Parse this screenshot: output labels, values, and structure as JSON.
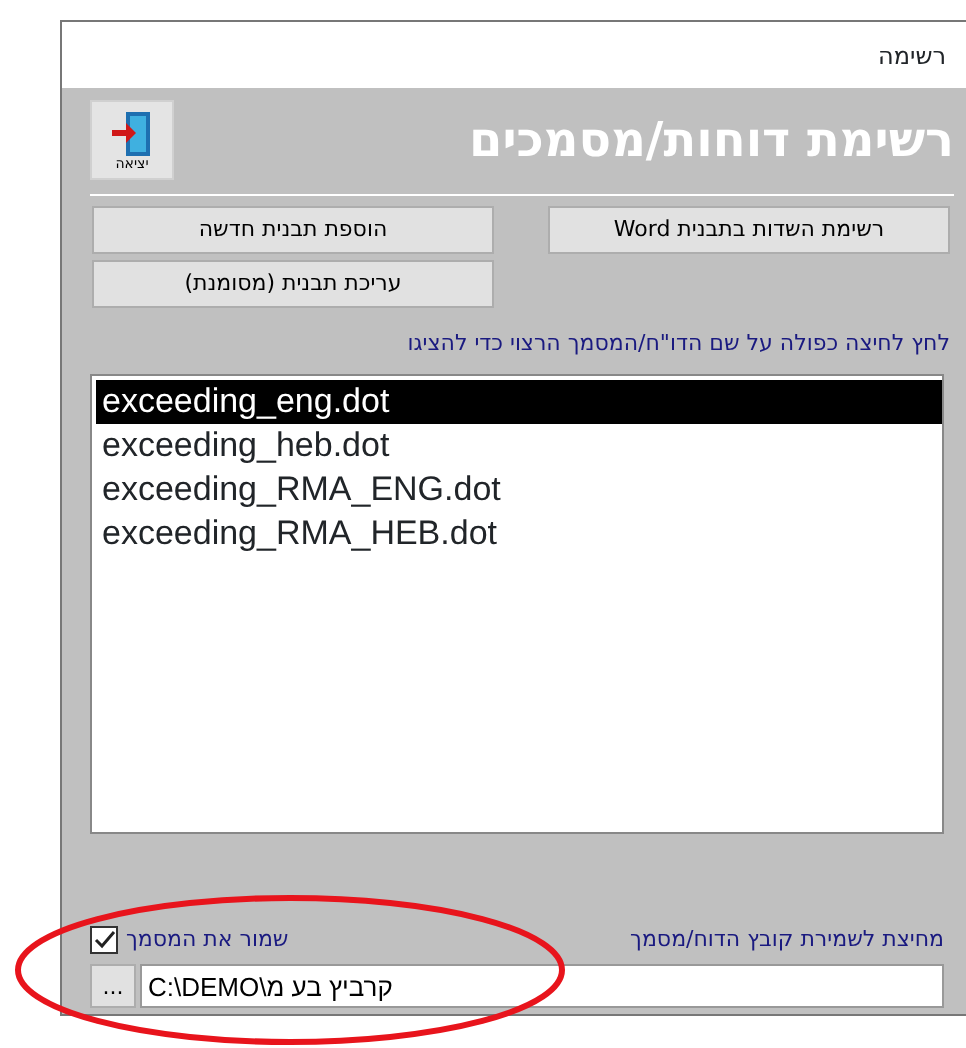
{
  "window": {
    "title": "רשימה"
  },
  "header": {
    "title": "רשימת דוחות/מסמכים",
    "exit_button": {
      "label": "יציאה"
    }
  },
  "buttons": [
    {
      "label": "רשימת השדות  בתבנית Word"
    },
    {
      "label": "הוספת תבנית חדשה"
    },
    {
      "label": "עריכת תבנית (מסומנת)"
    }
  ],
  "instruction": "לחץ לחיצה כפולה על שם הדו\"ח/המסמך הרצוי כדי להציגו",
  "templates": [
    {
      "name": "exceeding_eng.dot",
      "selected": true
    },
    {
      "name": "exceeding_heb.dot",
      "selected": false
    },
    {
      "name": "exceeding_RMA_ENG.dot",
      "selected": false
    },
    {
      "name": "exceeding_RMA_HEB.dot",
      "selected": false
    }
  ],
  "save_folder": {
    "label": "מחיצת לשמירת קובץ הדוח/מסמך",
    "value": "C:\\DEMO\\קרביץ בע מ",
    "browse_label": "..."
  },
  "save_document": {
    "label": "שמור את המסמך",
    "checked": true
  }
}
